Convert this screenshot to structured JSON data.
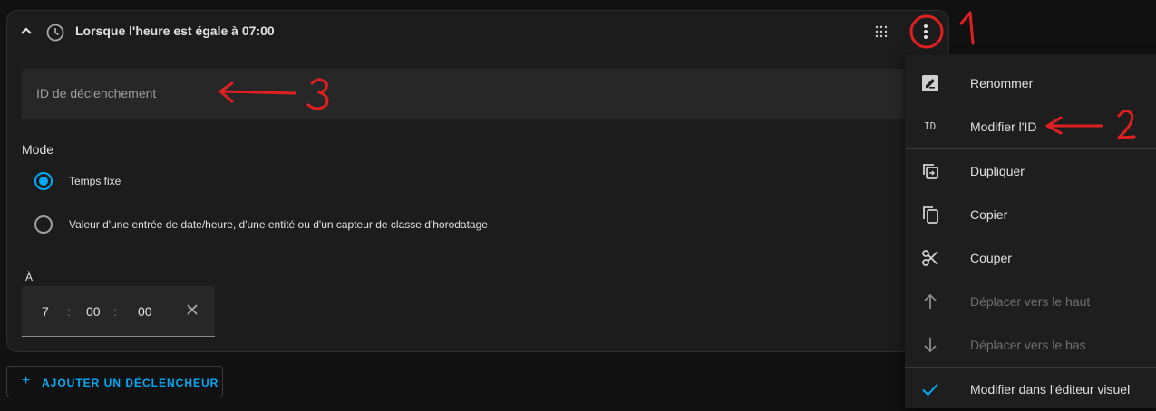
{
  "trigger": {
    "title": "Lorsque l'heure est égale à 07:00",
    "id_placeholder": "ID de déclenchement",
    "mode_label": "Mode",
    "modes": [
      {
        "label": "Temps fixe",
        "selected": true
      },
      {
        "label": "Valeur d'une entrée de date/heure, d'une entité ou d'un capteur de classe d'horodatage",
        "selected": false
      }
    ],
    "at_label": "À",
    "time": {
      "hours": "7",
      "minutes": "00",
      "seconds": "00",
      "separator": ":"
    }
  },
  "add_trigger": {
    "icon": "plus-icon",
    "label": "AJOUTER UN DÉCLENCHEUR"
  },
  "menu": {
    "items": [
      {
        "icon": "rename-icon",
        "label": "Renommer",
        "disabled": false
      },
      {
        "icon": "id-icon",
        "icon_text": "ID",
        "label": "Modifier l'ID",
        "disabled": false
      },
      {
        "icon": "duplicate-icon",
        "label": "Dupliquer",
        "disabled": false
      },
      {
        "icon": "copy-icon",
        "label": "Copier",
        "disabled": false
      },
      {
        "icon": "scissors-icon",
        "label": "Couper",
        "disabled": false
      },
      {
        "icon": "arrow-up-icon",
        "label": "Déplacer vers le haut",
        "disabled": true
      },
      {
        "icon": "arrow-down-icon",
        "label": "Déplacer vers le bas",
        "disabled": true
      },
      {
        "icon": "check-icon",
        "label": "Modifier dans l'éditeur visuel",
        "disabled": false
      }
    ]
  },
  "annotations": {
    "marks": [
      "1",
      "2",
      "3"
    ],
    "color": "#e02020"
  },
  "colors": {
    "accent": "#03a9f4",
    "background": "#111111",
    "card": "#1c1c1c",
    "menu": "#1e1e1e"
  }
}
